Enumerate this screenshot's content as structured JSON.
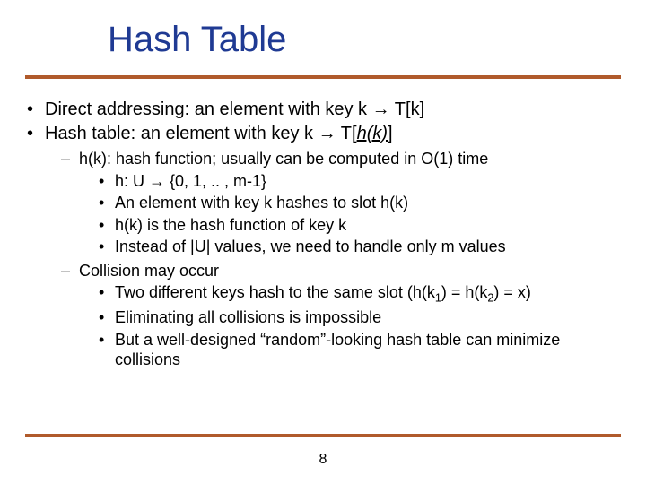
{
  "title": "Hash Table",
  "pageNumber": "8",
  "arrow": "→",
  "bullets": {
    "b0a_pre": "Direct addressing: an element with key k ",
    "b0a_post": " T[k]",
    "b0b_pre": "Hash table: an element with key k ",
    "b0b_post": " T[",
    "b0b_hk": "h(k)",
    "b0b_close": "]",
    "b1a": "h(k): hash function; usually can be computed in O(1) time",
    "b2a_pre": "h: U ",
    "b2a_post": " {0, 1, .. , m-1}",
    "b2b": "An element with key k hashes to slot h(k)",
    "b2c": "h(k) is the hash function of key k",
    "b2d": "Instead of |U| values, we need to handle only m values",
    "b1b": "Collision may occur",
    "b2e_pre": "Two different keys hash to the same slot (h(k",
    "b2e_sub1": "1",
    "b2e_mid": ") = h(k",
    "b2e_sub2": "2",
    "b2e_post": ") = x)",
    "b2f": "Eliminating all collisions is impossible",
    "b2g": "But a well-designed “random”-looking hash table can minimize collisions"
  }
}
